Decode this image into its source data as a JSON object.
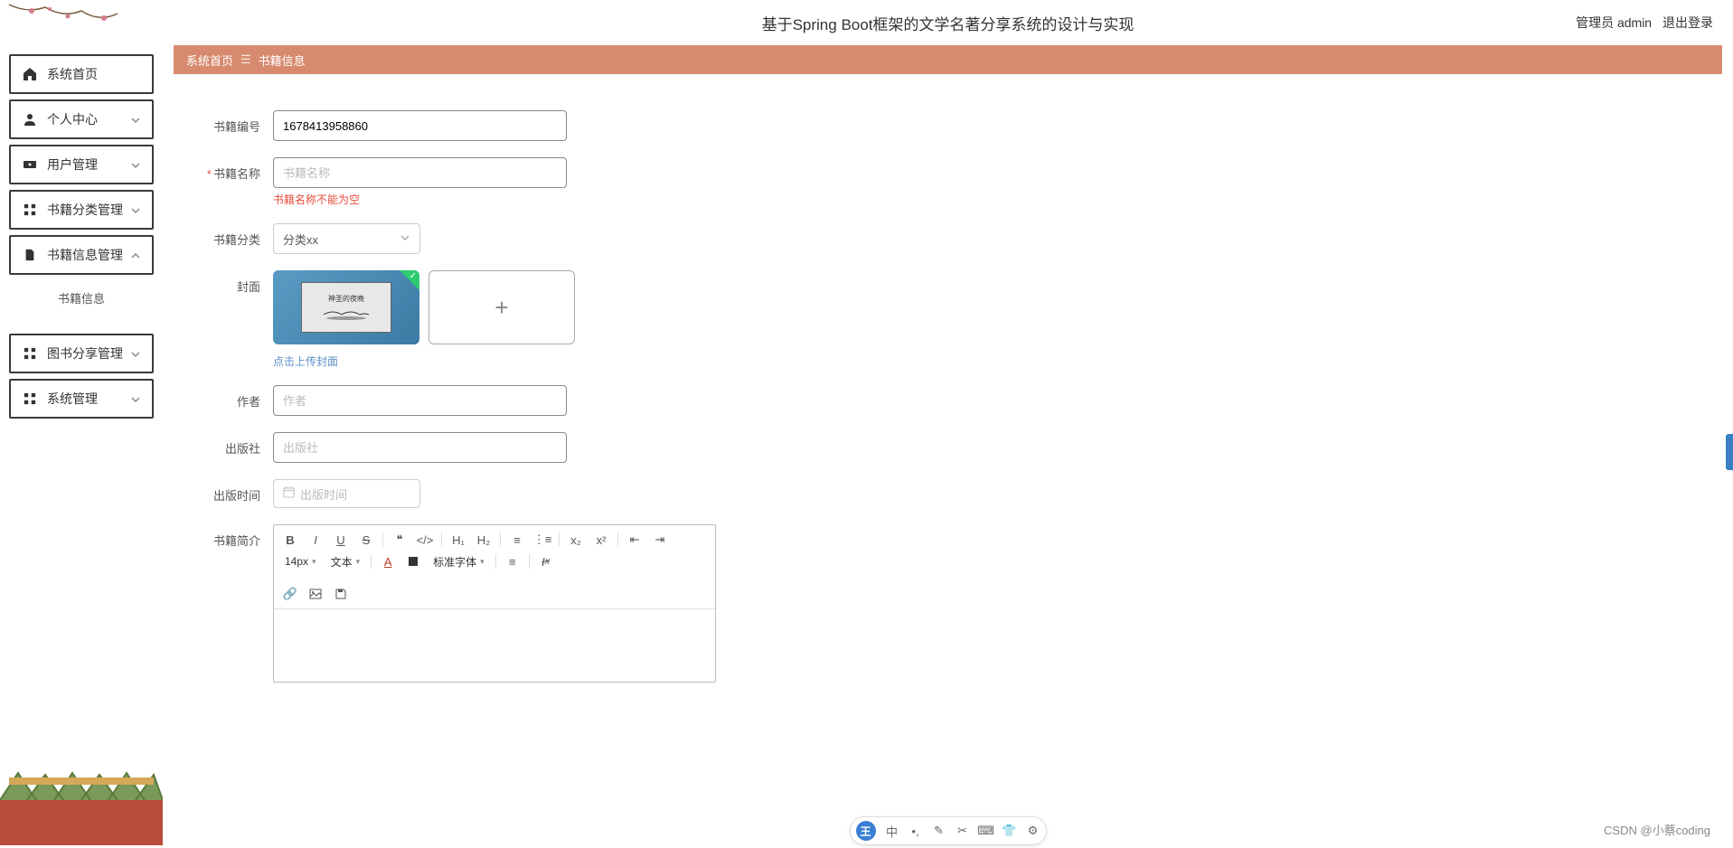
{
  "header": {
    "title": "基于Spring Boot框架的文学名著分享系统的设计与实现",
    "admin_label": "管理员 admin",
    "logout": "退出登录"
  },
  "breadcrumb": {
    "home": "系统首页",
    "current": "书籍信息"
  },
  "sidebar": {
    "items": [
      {
        "label": "系统首页",
        "icon": "home",
        "expandable": false
      },
      {
        "label": "个人中心",
        "icon": "user",
        "expandable": true
      },
      {
        "label": "用户管理",
        "icon": "ticket",
        "expandable": true
      },
      {
        "label": "书籍分类管理",
        "icon": "grid",
        "expandable": true
      },
      {
        "label": "书籍信息管理",
        "icon": "file",
        "expandable": true,
        "expanded": true
      },
      {
        "label": "图书分享管理",
        "icon": "grid",
        "expandable": true
      },
      {
        "label": "系统管理",
        "icon": "grid",
        "expandable": true
      }
    ],
    "sub_item": "书籍信息"
  },
  "form": {
    "book_id": {
      "label": "书籍编号",
      "value": "1678413958860"
    },
    "book_name": {
      "label": "书籍名称",
      "placeholder": "书籍名称",
      "error": "书籍名称不能为空",
      "required": true
    },
    "category": {
      "label": "书籍分类",
      "value": "分类xx"
    },
    "cover": {
      "label": "封面",
      "hint": "点击上传封面",
      "preview_title": "神圣的夜晚"
    },
    "author": {
      "label": "作者",
      "placeholder": "作者"
    },
    "publisher": {
      "label": "出版社",
      "placeholder": "出版社"
    },
    "pub_date": {
      "label": "出版时间",
      "placeholder": "出版时间"
    },
    "summary": {
      "label": "书籍简介"
    }
  },
  "editor": {
    "font_size": "14px",
    "format": "文本",
    "font_family": "标准字体"
  },
  "watermark": "CSDN @小蔡coding"
}
